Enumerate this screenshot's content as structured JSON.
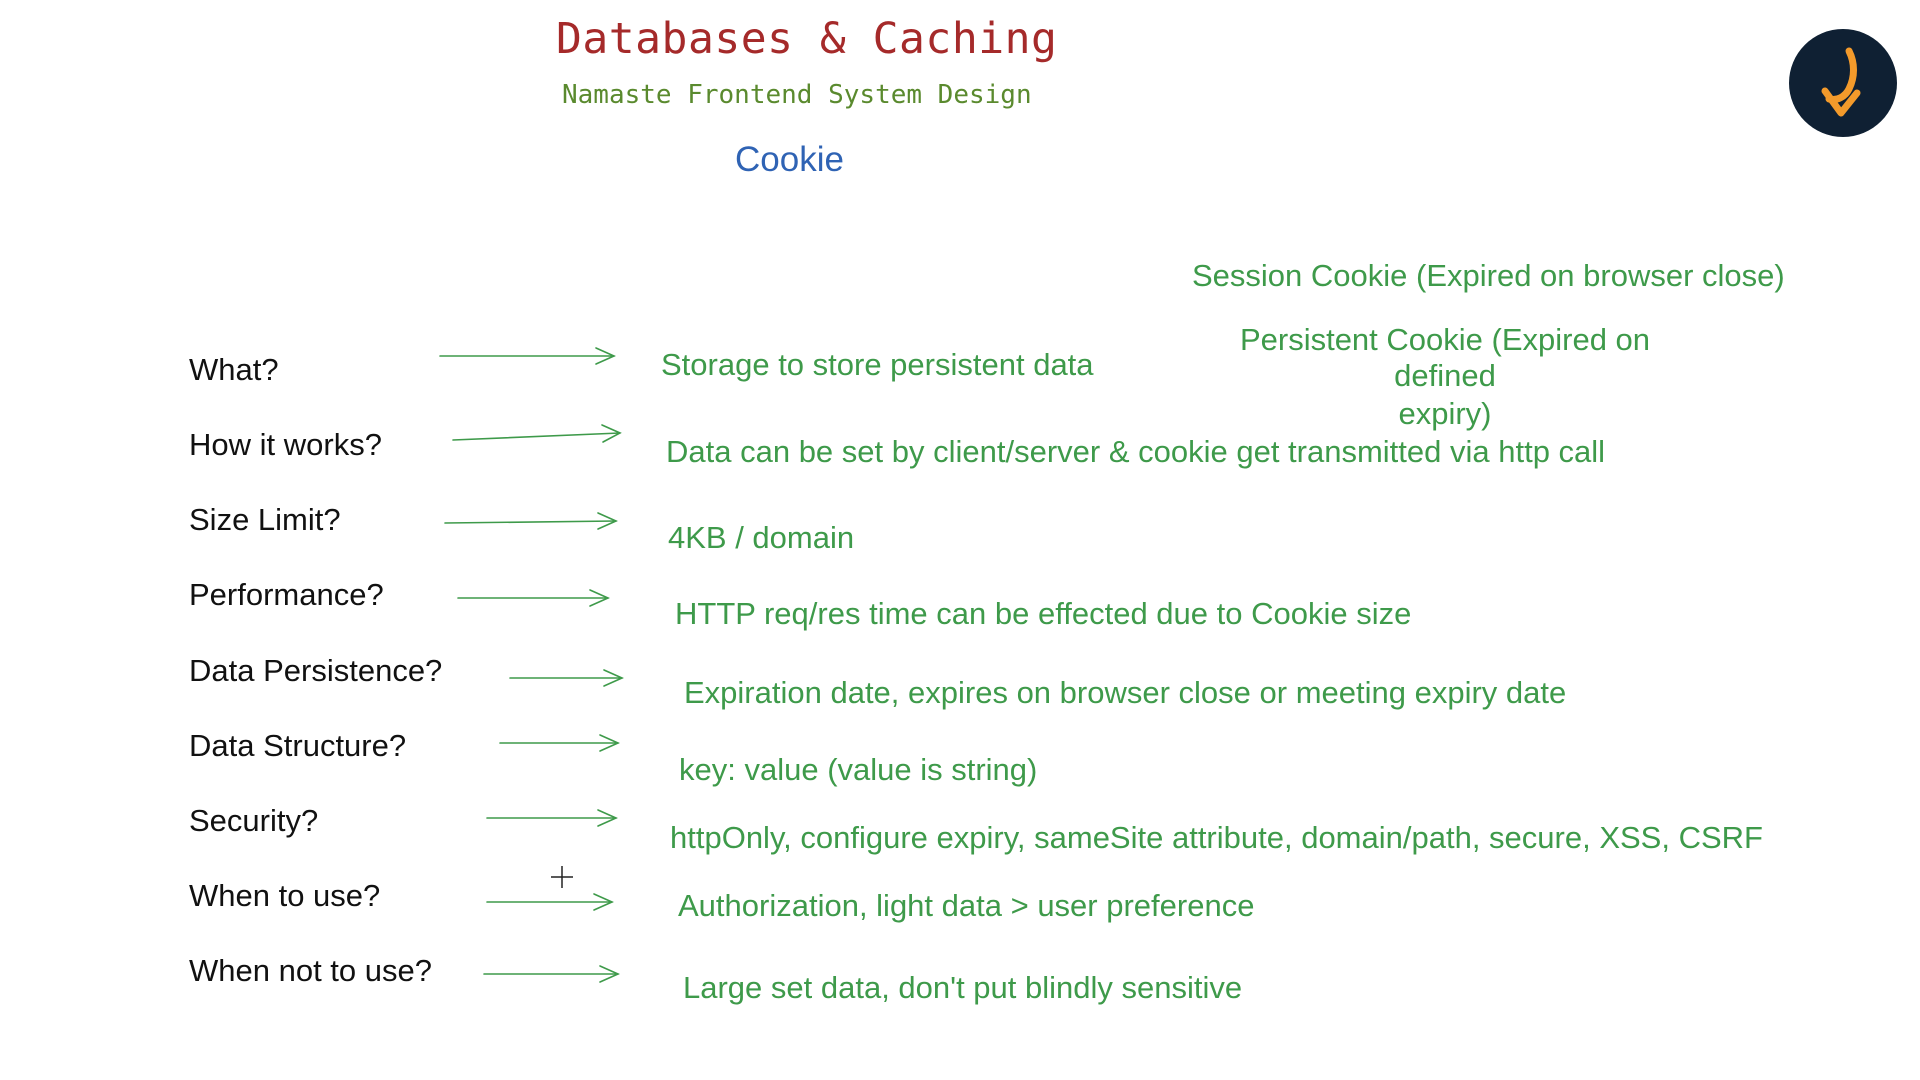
{
  "slide": {
    "title": "Databases & Caching",
    "subtitle": "Namaste Frontend System Design",
    "heading": "Cookie",
    "side_notes": {
      "session": "Session Cookie (Expired on browser close)",
      "persistent_line1": "Persistent Cookie (Expired on defined",
      "persistent_line2": "expiry)"
    },
    "rows": [
      {
        "question": "What?",
        "answer": "Storage to store persistent data"
      },
      {
        "question": "How it works?",
        "answer": "Data can be set by client/server & cookie get transmitted via http call"
      },
      {
        "question": "Size Limit?",
        "answer": "4KB / domain"
      },
      {
        "question": "Performance?",
        "answer": "HTTP req/res time can be effected due to Cookie size"
      },
      {
        "question": "Data Persistence?",
        "answer": "Expiration date, expires on browser close or meeting expiry date"
      },
      {
        "question": "Data Structure?",
        "answer": "key: value (value is string)"
      },
      {
        "question": "Security?",
        "answer": "httpOnly, configure expiry, sameSite attribute, domain/path, secure, XSS, CSRF"
      },
      {
        "question": "When to use?",
        "answer": "Authorization, light data > user preference"
      },
      {
        "question": "When not to use?",
        "answer": "Large set data, don't put blindly sensitive"
      }
    ]
  },
  "colors": {
    "title": "#a52a2a",
    "subtitle": "#5a8a2e",
    "heading": "#2f63b4",
    "answer": "#3e9a4a",
    "question": "#111111",
    "logo_bg": "#0f2033",
    "logo_mark": "#f39a2b"
  },
  "icons": {
    "logo": "namaste-dev-logo-icon",
    "arrow": "right-arrow-icon",
    "cursor": "crosshair-cursor-icon"
  }
}
